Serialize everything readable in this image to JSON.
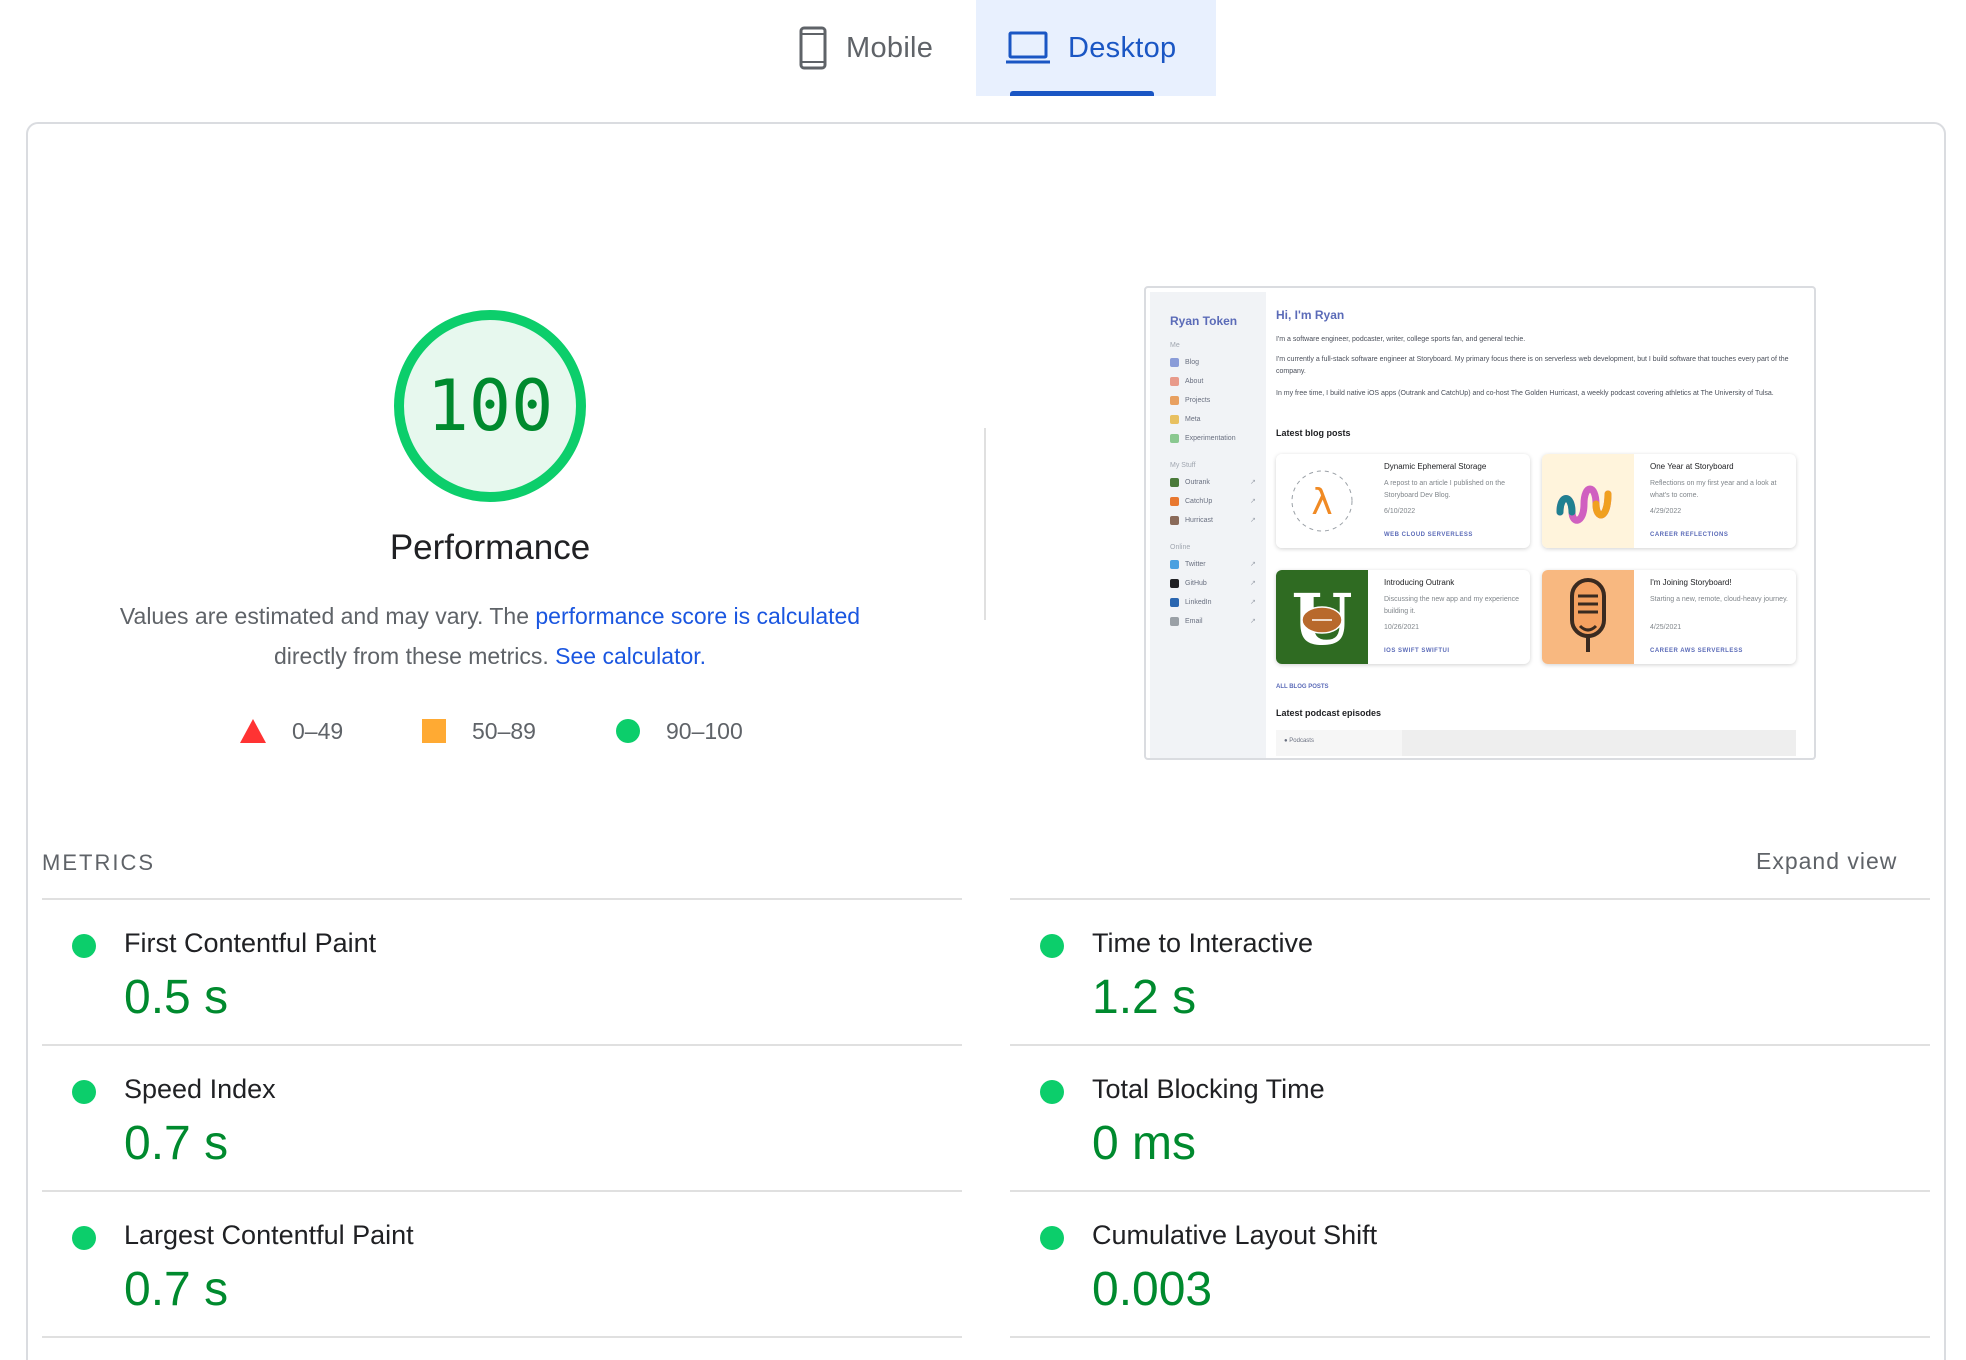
{
  "tabs": {
    "mobile": {
      "label": "Mobile",
      "icon": "phone-icon",
      "selected": false
    },
    "desktop": {
      "label": "Desktop",
      "icon": "laptop-icon",
      "selected": true
    }
  },
  "performance": {
    "score": "100",
    "score_fraction": 1.0,
    "title": "Performance",
    "desc_prefix": "Values are estimated and may vary. The ",
    "desc_link1": "performance score is calculated",
    "desc_middle": " directly from these metrics. ",
    "desc_link2": "See calculator."
  },
  "legend": {
    "fail": "0–49",
    "average": "50–89",
    "pass": "90–100"
  },
  "thumbnail": {
    "brand": "Ryan Token",
    "sections": {
      "me": "Me",
      "my_stuff": "My Stuff",
      "online": "Online"
    },
    "nav_me": [
      "Blog",
      "About",
      "Projects",
      "Meta",
      "Experimentation"
    ],
    "nav_stuff": [
      "Outrank",
      "CatchUp",
      "Hurricast"
    ],
    "nav_online": [
      "Twitter",
      "GitHub",
      "LinkedIn",
      "Email"
    ],
    "hello": "Hi, I'm Ryan",
    "para1": "I'm a software engineer, podcaster, writer, college sports fan, and general techie.",
    "para2": "I'm currently a full-stack software engineer at Storyboard. My primary focus there is on serverless web development, but I build software that touches every part of the company.",
    "para3": "In my free time, I build native iOS apps (Outrank and CatchUp) and co-host The Golden Hurricast, a weekly podcast covering athletics at The University of Tulsa.",
    "latest_blog": "Latest blog posts",
    "posts": [
      {
        "title": "Dynamic Ephemeral Storage",
        "desc": "A repost to an article I published on the Storyboard Dev Blog.",
        "date": "6/10/2022",
        "tags": "WEB   CLOUD   SERVERLESS"
      },
      {
        "title": "One Year at Storyboard",
        "desc": "Reflections on my first year and a look at what's to come.",
        "date": "4/29/2022",
        "tags": "CAREER   REFLECTIONS"
      },
      {
        "title": "Introducing Outrank",
        "desc": "Discussing the new app and my experience building it.",
        "date": "10/26/2021",
        "tags": "IOS   SWIFT   SWIFTUI"
      },
      {
        "title": "I'm Joining Storyboard!",
        "desc": "Starting a new, remote, cloud-heavy journey.",
        "date": "4/25/2021",
        "tags": "CAREER   AWS   SERVERLESS"
      }
    ],
    "all_posts": "ALL BLOG POSTS",
    "latest_podcast": "Latest podcast episodes",
    "podcast_tab": "● Podcasts"
  },
  "metrics": {
    "label": "METRICS",
    "expand": "Expand view",
    "left": [
      {
        "name": "First Contentful Paint",
        "value": "0.5 s"
      },
      {
        "name": "Speed Index",
        "value": "0.7 s"
      },
      {
        "name": "Largest Contentful Paint",
        "value": "0.7 s"
      }
    ],
    "right": [
      {
        "name": "Time to Interactive",
        "value": "1.2 s"
      },
      {
        "name": "Total Blocking Time",
        "value": "0 ms"
      },
      {
        "name": "Cumulative Layout Shift",
        "value": "0.003"
      }
    ]
  },
  "colors": {
    "pass": "#0cce6b",
    "pass_text": "#008a2e",
    "average": "#ffaa33",
    "fail": "#ff3333",
    "link": "#1a56e0",
    "tab_active": "#1a56c4"
  }
}
